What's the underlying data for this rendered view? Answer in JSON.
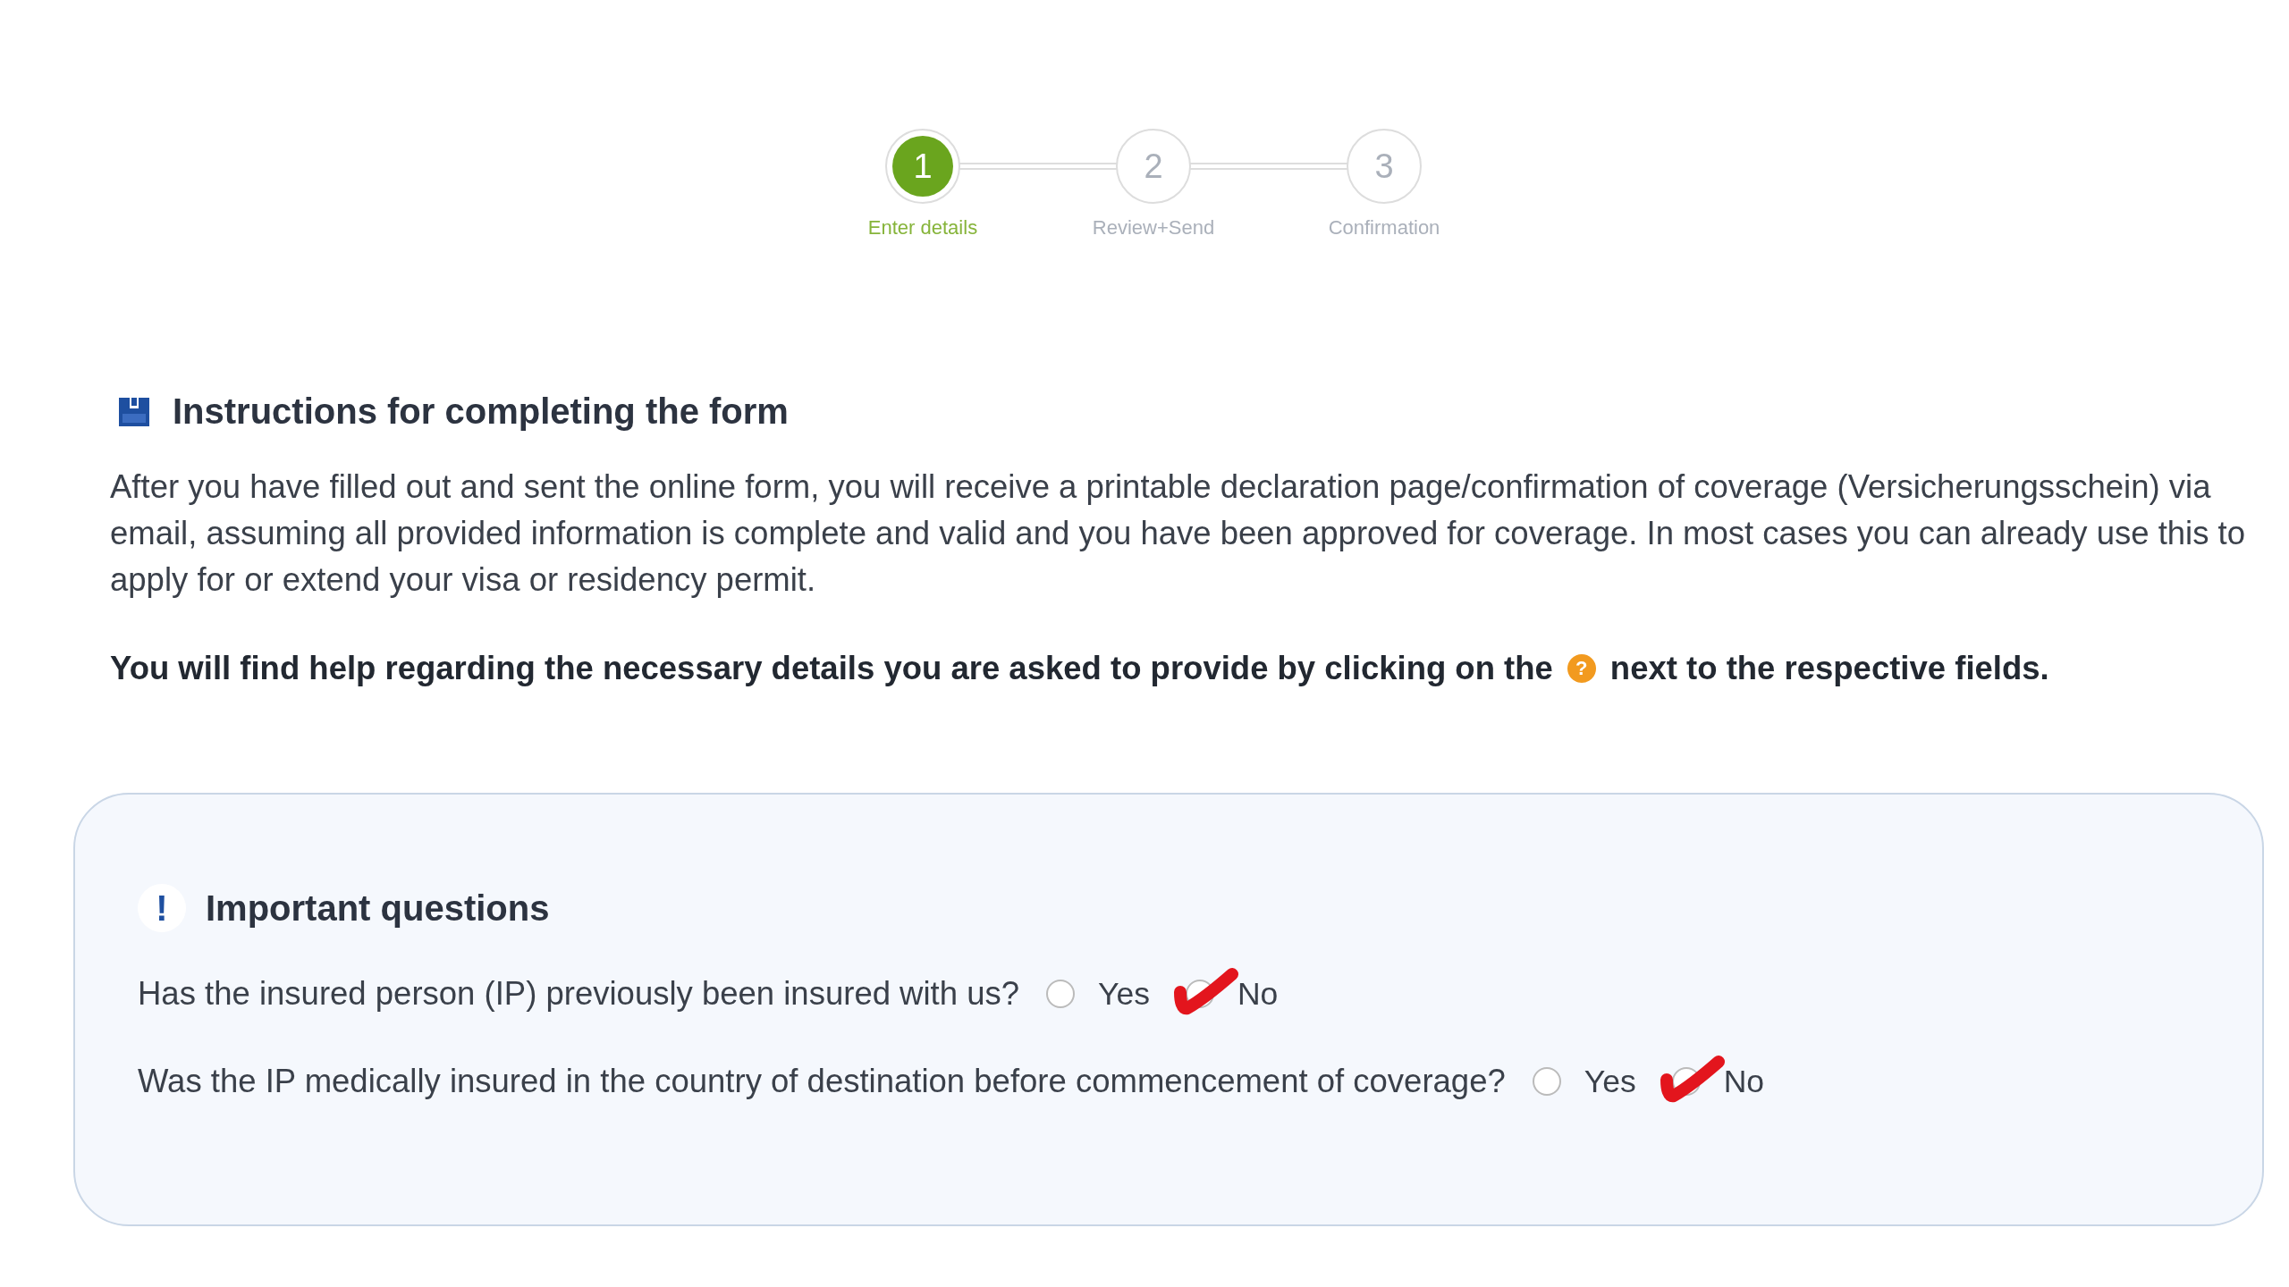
{
  "stepper": [
    {
      "number": "1",
      "label": "Enter details",
      "selected": true
    },
    {
      "number": "2",
      "label": "Review+Send",
      "selected": false
    },
    {
      "number": "3",
      "label": "Confirmation",
      "selected": false
    }
  ],
  "instructions": {
    "title": "Instructions for completing the form",
    "paragraph": "After you have filled out and sent the online form, you will receive a printable declaration page/confirmation of coverage (Versicherungsschein) via email, assuming all provided information is complete and valid and you have been approved for coverage. In most cases you can already use this to apply for or extend your visa or residency permit.",
    "help_before": "You will find help regarding the necessary details you are asked to provide by clicking on the",
    "help_icon": "?",
    "help_after": "next to the respective fields."
  },
  "important": {
    "icon": "!",
    "title": "Important questions",
    "questions": [
      {
        "text": "Has the insured person (IP) previously been insured with us?",
        "options": [
          {
            "label": "Yes",
            "selected": false
          },
          {
            "label": "No",
            "selected": true
          }
        ]
      },
      {
        "text": "Was the IP medically insured in the country of destination before commencement of coverage?",
        "options": [
          {
            "label": "Yes",
            "selected": false
          },
          {
            "label": "No",
            "selected": true
          }
        ]
      }
    ]
  }
}
